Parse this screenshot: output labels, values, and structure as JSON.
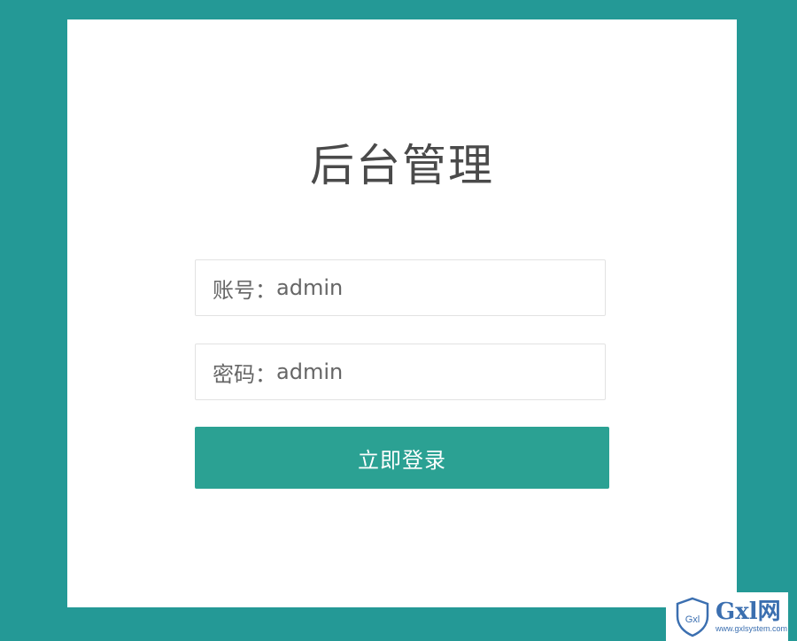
{
  "title": "后台管理",
  "username": {
    "label": "账号：",
    "value": "admin"
  },
  "password": {
    "label": "密码：",
    "value": "admin"
  },
  "submit_label": "立即登录",
  "watermark": {
    "shield_text": "Gxl",
    "brand": "Gxl网",
    "url": "www.gxlsystem.com"
  },
  "colors": {
    "page_background": "#249996",
    "card_background": "#ffffff",
    "button_background": "#2ba193",
    "button_text": "#ffffff",
    "field_border": "#e2e2e2",
    "title_text": "#4a4a4a",
    "watermark_blue": "#3b6fb0"
  }
}
